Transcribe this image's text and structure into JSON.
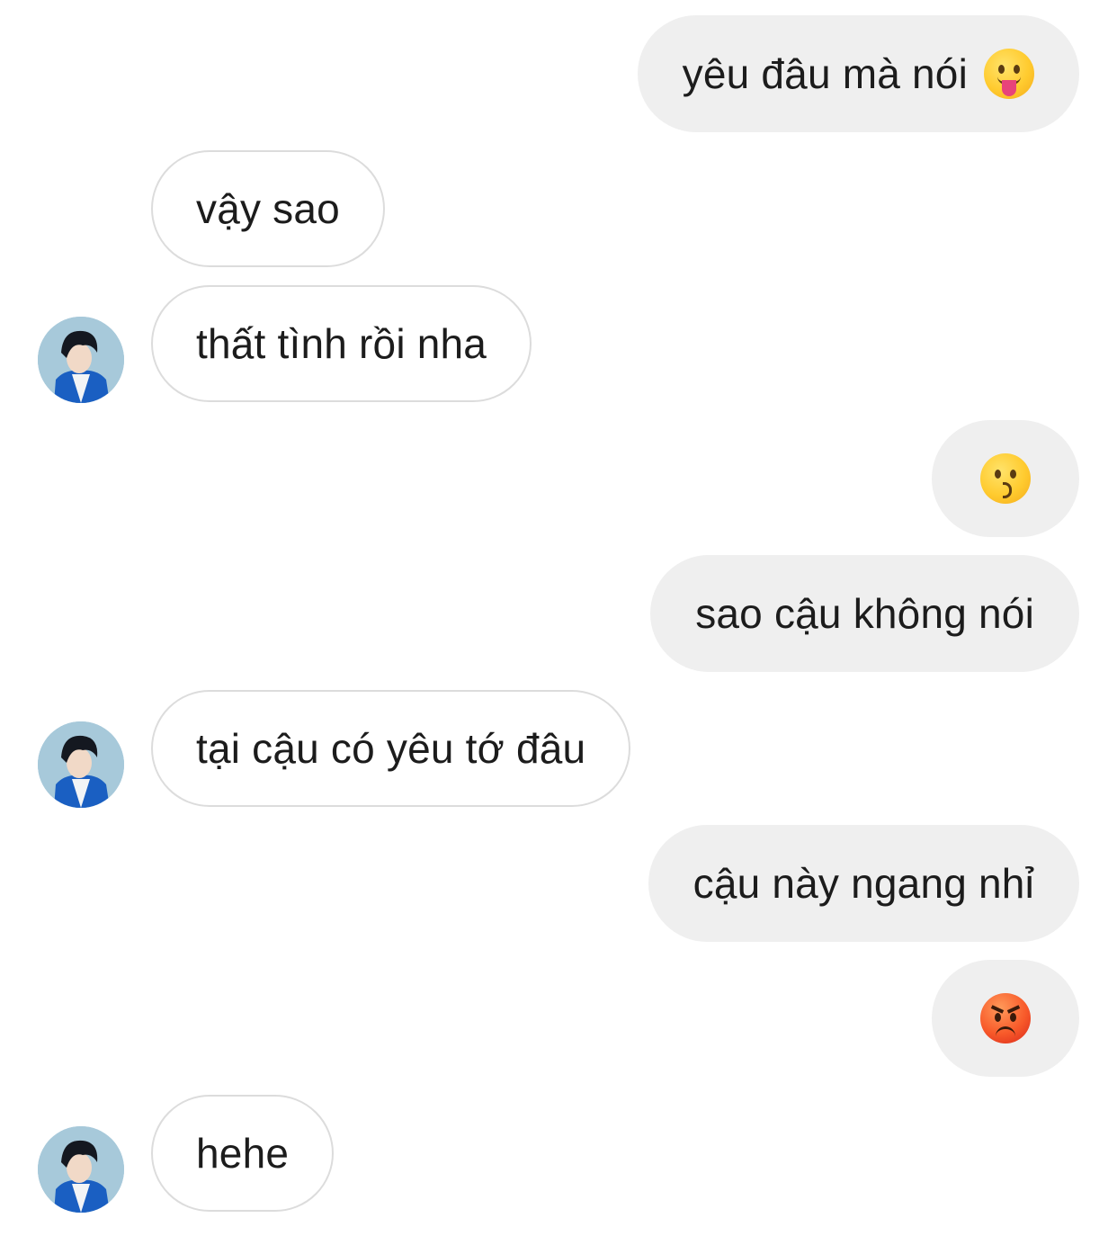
{
  "messages": [
    {
      "side": "out",
      "text": "yêu đâu mà nói",
      "emoji": "tongue-face"
    },
    {
      "side": "in",
      "text": "vậy sao"
    },
    {
      "side": "in",
      "text": "thất tình rồi nha"
    },
    {
      "side": "out",
      "emoji": "kissing-face"
    },
    {
      "side": "out",
      "text": "sao cậu không nói"
    },
    {
      "side": "in",
      "text": "tại cậu có yêu tớ đâu"
    },
    {
      "side": "out",
      "text": "cậu này ngang nhỉ"
    },
    {
      "side": "out",
      "emoji": "angry-face"
    },
    {
      "side": "in",
      "text": "hehe"
    }
  ],
  "colors": {
    "outgoing_bubble": "#efefef",
    "incoming_border": "#dcdcdc",
    "text": "#1c1c1c"
  }
}
